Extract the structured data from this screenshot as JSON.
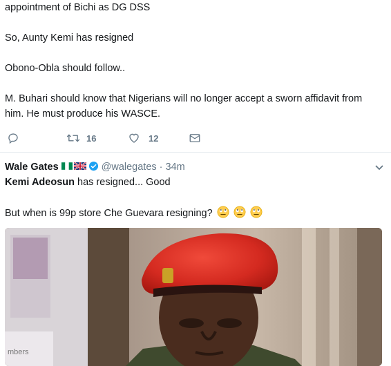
{
  "tweet1": {
    "lines": [
      "appointment of Bichi as DG DSS",
      "So, Aunty Kemi has resigned",
      "Obono-Obla should follow..",
      "M. Buhari should know that Nigerians will no longer accept a sworn affidavit from",
      "him. He must produce his WASCE."
    ],
    "actions": {
      "retweet_count": "16",
      "like_count": "12"
    }
  },
  "tweet2": {
    "display_name": "Wale Gates",
    "handle": "@walegates",
    "time": "· 34m",
    "line1_bold": "Kemi Adeosun",
    "line1_rest": " has resigned...  Good",
    "line2": "But when is 99p store Che Guevara resigning?",
    "emoji_count_label": "🙄🙄🙄",
    "media_caption_fragment": "mbers"
  },
  "colors": {
    "text": "#14171a",
    "muted": "#657786",
    "divider": "#e6ecf0",
    "verified": "#1da1f2"
  }
}
